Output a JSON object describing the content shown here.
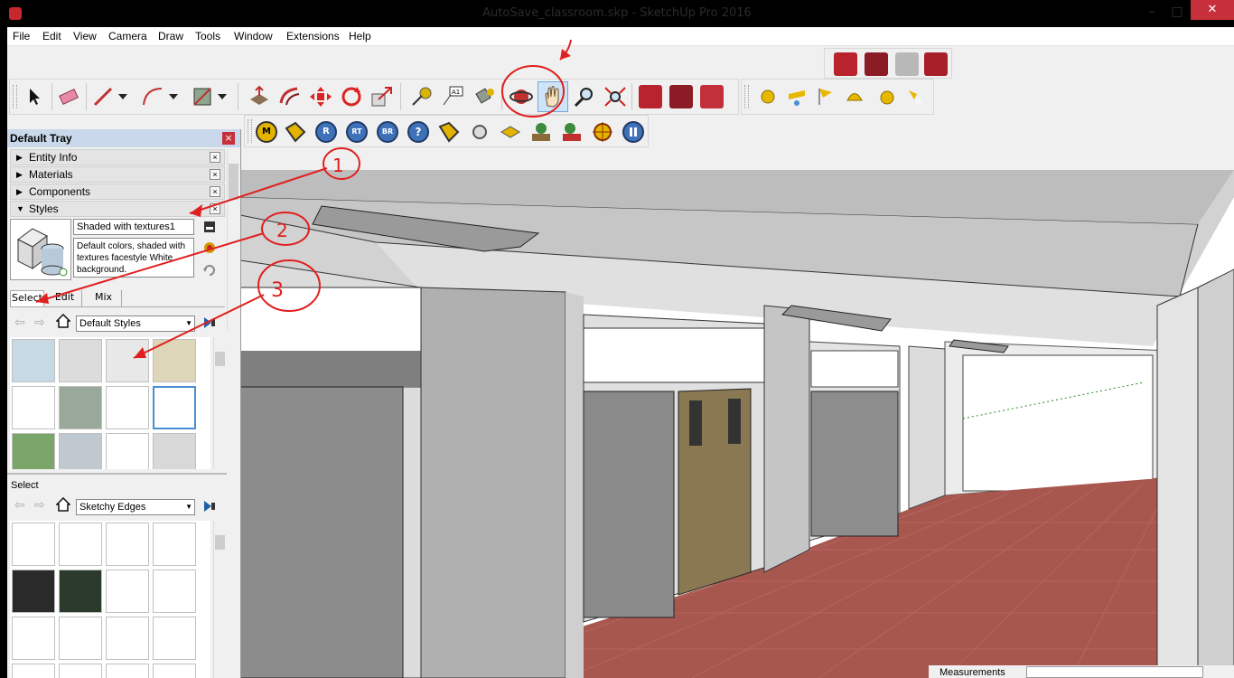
{
  "window": {
    "title": "AutoSave_classroom.skp - SketchUp Pro 2016",
    "minimize": "–",
    "maximize": "□",
    "close": "✕"
  },
  "menu": [
    "File",
    "Edit",
    "View",
    "Camera",
    "Draw",
    "Tools",
    "Window",
    "Extensions",
    "Help"
  ],
  "tray": {
    "title": "Default Tray",
    "close_glyph": "×",
    "panels": [
      {
        "label": "Entity Info",
        "arrow": "▶"
      },
      {
        "label": "Materials",
        "arrow": "▶"
      },
      {
        "label": "Components",
        "arrow": "▶"
      },
      {
        "label": "Styles",
        "arrow": "▼"
      }
    ],
    "styles": {
      "name": "Shaded with textures1",
      "description": "Default colors, shaded with textures facestyle White background.",
      "tabs": [
        "Select",
        "Edit",
        "Mix"
      ],
      "library": "Default Styles",
      "secondary_label": "Select",
      "secondary_library": "Sketchy Edges"
    }
  },
  "status": {
    "measurements": "Measurements"
  },
  "annotations": {
    "one": "1",
    "two": "2",
    "three": "3"
  },
  "icons": {
    "select": "arrow-cursor-icon",
    "eraser": "eraser-icon",
    "pencil": "pencil-icon",
    "arc": "arc-icon",
    "rect": "rectangle-icon",
    "pushpull": "push-pull-icon",
    "offset": "offset-icon",
    "move": "move-icon",
    "rotate": "rotate-icon",
    "scale": "scale-icon",
    "tape": "tape-measure-icon",
    "text": "text-icon",
    "paint": "paint-bucket-icon",
    "orbit": "orbit-icon",
    "pan": "pan-hand-icon",
    "zoom": "zoom-icon",
    "zoomext": "zoom-extents-icon"
  }
}
